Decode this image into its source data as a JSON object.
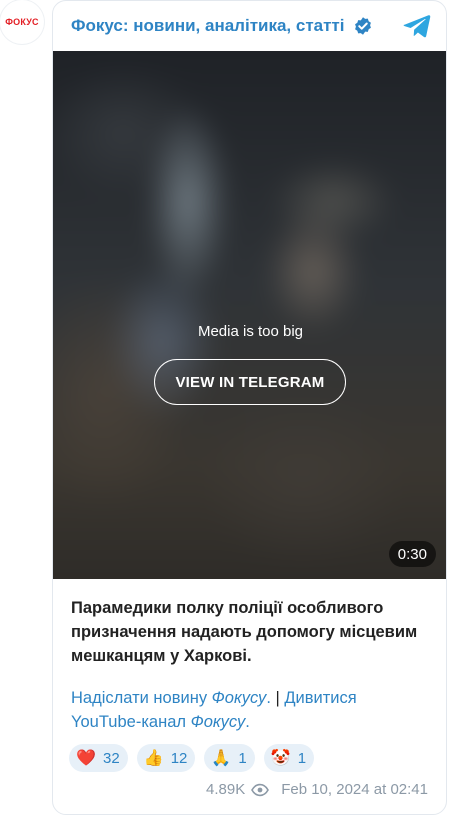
{
  "channel": {
    "avatar_text": "ФОКУС",
    "name": "Фокус: новини, аналітика, статті",
    "verified_icon": "verified-badge-icon",
    "telegram_icon": "telegram-icon"
  },
  "media": {
    "notice": "Media is too big",
    "view_button": "VIEW IN TELEGRAM",
    "duration": "0:30"
  },
  "post": {
    "text": "Парамедики полку поліції особливого призначення надають допомогу місцевим мешканцям у Харкові.",
    "links": {
      "send_news": "Надіслати новину ",
      "focus_1": "Фокусу",
      "dot": ".",
      "separator": " | ",
      "watch": "Дивитися YouTube-канал ",
      "focus_2": "Фокусу",
      "end": "."
    }
  },
  "reactions": [
    {
      "emoji": "❤️",
      "count": "32"
    },
    {
      "emoji": "👍",
      "count": "12"
    },
    {
      "emoji": "🙏",
      "count": "1"
    },
    {
      "emoji": "🤡",
      "count": "1"
    }
  ],
  "meta": {
    "views": "4.89K",
    "date": "Feb 10, 2024 at 02:41"
  },
  "colors": {
    "accent": "#2e84c4",
    "brand_red": "#e31e24",
    "reaction_bg": "#e7f0f8",
    "meta_gray": "#8c99a6"
  }
}
